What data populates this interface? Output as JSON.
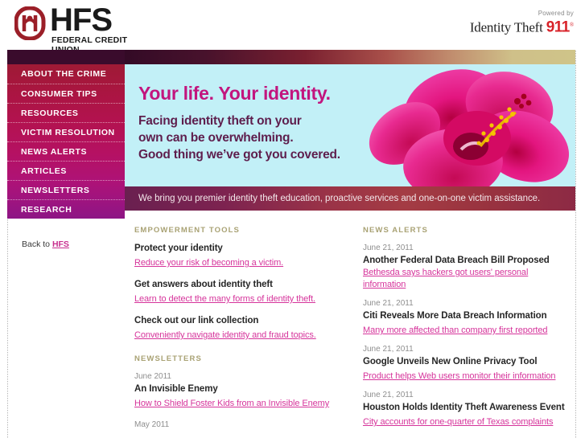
{
  "header": {
    "brand_name": "HFS",
    "brand_sub": "FEDERAL CREDIT UNION",
    "powered_by": "Powered by",
    "partner_name": "Identity Theft",
    "partner_number": "911",
    "partner_tm": "®",
    "logo_color": "#9b1f28",
    "partner_red": "#d8232a"
  },
  "sidebar": {
    "items": [
      {
        "label": "ABOUT THE CRIME"
      },
      {
        "label": "CONSUMER TIPS"
      },
      {
        "label": "RESOURCES"
      },
      {
        "label": "VICTIM RESOLUTION"
      },
      {
        "label": "NEWS ALERTS"
      },
      {
        "label": "ARTICLES"
      },
      {
        "label": "NEWSLETTERS"
      },
      {
        "label": "RESEARCH"
      }
    ],
    "back_prefix": "Back to ",
    "back_link": "HFS",
    "gradient_from": "#9e1a35",
    "gradient_to": "#8d1585"
  },
  "hero": {
    "headline": "Your life. Your identity.",
    "line1": "Facing identity theft on your",
    "line2": "own can be overwhelming.",
    "line3": "Good thing we’ve got you covered.",
    "background": "#c2f0f7",
    "headline_color": "#c2157e",
    "image_name": "pink-hibiscus-flower"
  },
  "tagline": {
    "text": "We bring you premier identity theft education, proactive services and one-on-one victim assistance."
  },
  "empowerment": {
    "heading": "EMPOWERMENT TOOLS",
    "items": [
      {
        "title": "Protect your identity",
        "link": "Reduce your risk of becoming a victim."
      },
      {
        "title": "Get answers about identity theft",
        "link": "Learn to detect the many forms of identity theft."
      },
      {
        "title": "Check out our link collection",
        "link": "Conveniently navigate identity and fraud topics."
      }
    ]
  },
  "newsletters": {
    "heading": "NEWSLETTERS",
    "items": [
      {
        "date": "June 2011",
        "title": "An Invisible Enemy",
        "link": "How to Shield Foster Kids from an Invisible Enemy"
      },
      {
        "date": "May 2011",
        "title": "",
        "link": ""
      }
    ]
  },
  "news_alerts": {
    "heading": "NEWS ALERTS",
    "items": [
      {
        "date": "June 21, 2011",
        "title": "Another Federal Data Breach Bill Proposed",
        "link": "Bethesda says hackers got users' personal information"
      },
      {
        "date": "June 21, 2011",
        "title": "Citi Reveals More Data Breach Information",
        "link": "Many more affected than company first reported"
      },
      {
        "date": "June 21, 2011",
        "title": "Google Unveils New Online Privacy Tool",
        "link": "Product helps Web users monitor their information"
      },
      {
        "date": "June 21, 2011",
        "title": "Houston Holds Identity Theft Awareness Event",
        "link": "City accounts for one-quarter of Texas complaints"
      }
    ]
  },
  "colors": {
    "link_pink": "#d6349b",
    "section_head": "#a9a274",
    "topbar_dark": "#330a26",
    "topbar_tan": "#cfc489"
  }
}
